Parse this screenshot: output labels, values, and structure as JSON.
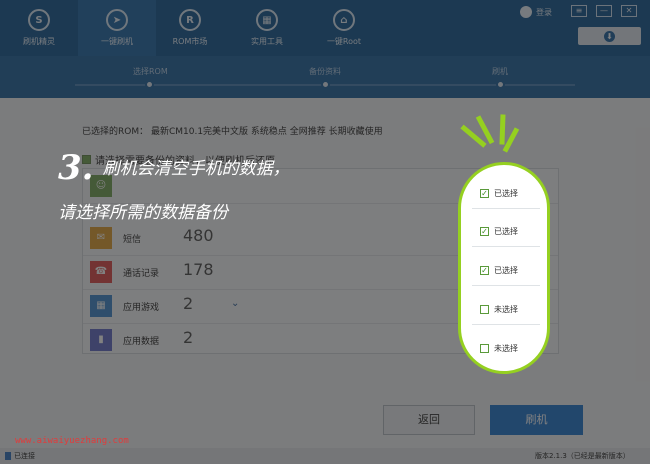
{
  "nav": {
    "items": [
      {
        "label": "刷机精灵",
        "icon": "S"
      },
      {
        "label": "一键刷机",
        "icon": "➤"
      },
      {
        "label": "ROM市场",
        "icon": "R"
      },
      {
        "label": "实用工具",
        "icon": "▦"
      },
      {
        "label": "一键Root",
        "icon": "⌂"
      }
    ],
    "login": "登录"
  },
  "window_controls": {
    "settings": "≡",
    "minimize": "—",
    "close": "✕"
  },
  "download_icon": "⬇",
  "steps": [
    "选择ROM",
    "备份资料",
    "刷机"
  ],
  "rom_line": "已选择的ROM：  最新CM10.1完美中文版 系统稳点 全网推荐 长期收藏使用",
  "prompt": "请选择需要备份的资料，以便刷机后还原",
  "rows": [
    {
      "label": "",
      "count": "",
      "icon": "contacts-icon"
    },
    {
      "label": "短信",
      "count": "480",
      "icon": "sms-icon"
    },
    {
      "label": "通话记录",
      "count": "178",
      "icon": "phone-icon"
    },
    {
      "label": "应用游戏",
      "count": "2",
      "icon": "apps-icon"
    },
    {
      "label": "应用数据",
      "count": "2",
      "icon": "chart-icon"
    }
  ],
  "callout_items": [
    {
      "label": "已选择",
      "checked": "✓"
    },
    {
      "label": "已选择",
      "checked": "✓"
    },
    {
      "label": "已选择",
      "checked": "✓"
    },
    {
      "label": "未选择",
      "checked": ""
    },
    {
      "label": "未选择",
      "checked": ""
    }
  ],
  "annotation": {
    "number": "3.",
    "line1": "刷机会清空手机的数据，",
    "line2": "请选择所需的数据备份"
  },
  "buttons": {
    "back": "返回",
    "flash": "刷机"
  },
  "watermark": "www.aiwaiyuezhang.com",
  "status": {
    "left": "已连接",
    "right": "版本2.1.3（已经是最新版本）"
  },
  "colors": {
    "primary": "#1f5f97",
    "accent_green": "#95d020",
    "button_blue": "#2e7ed1"
  }
}
